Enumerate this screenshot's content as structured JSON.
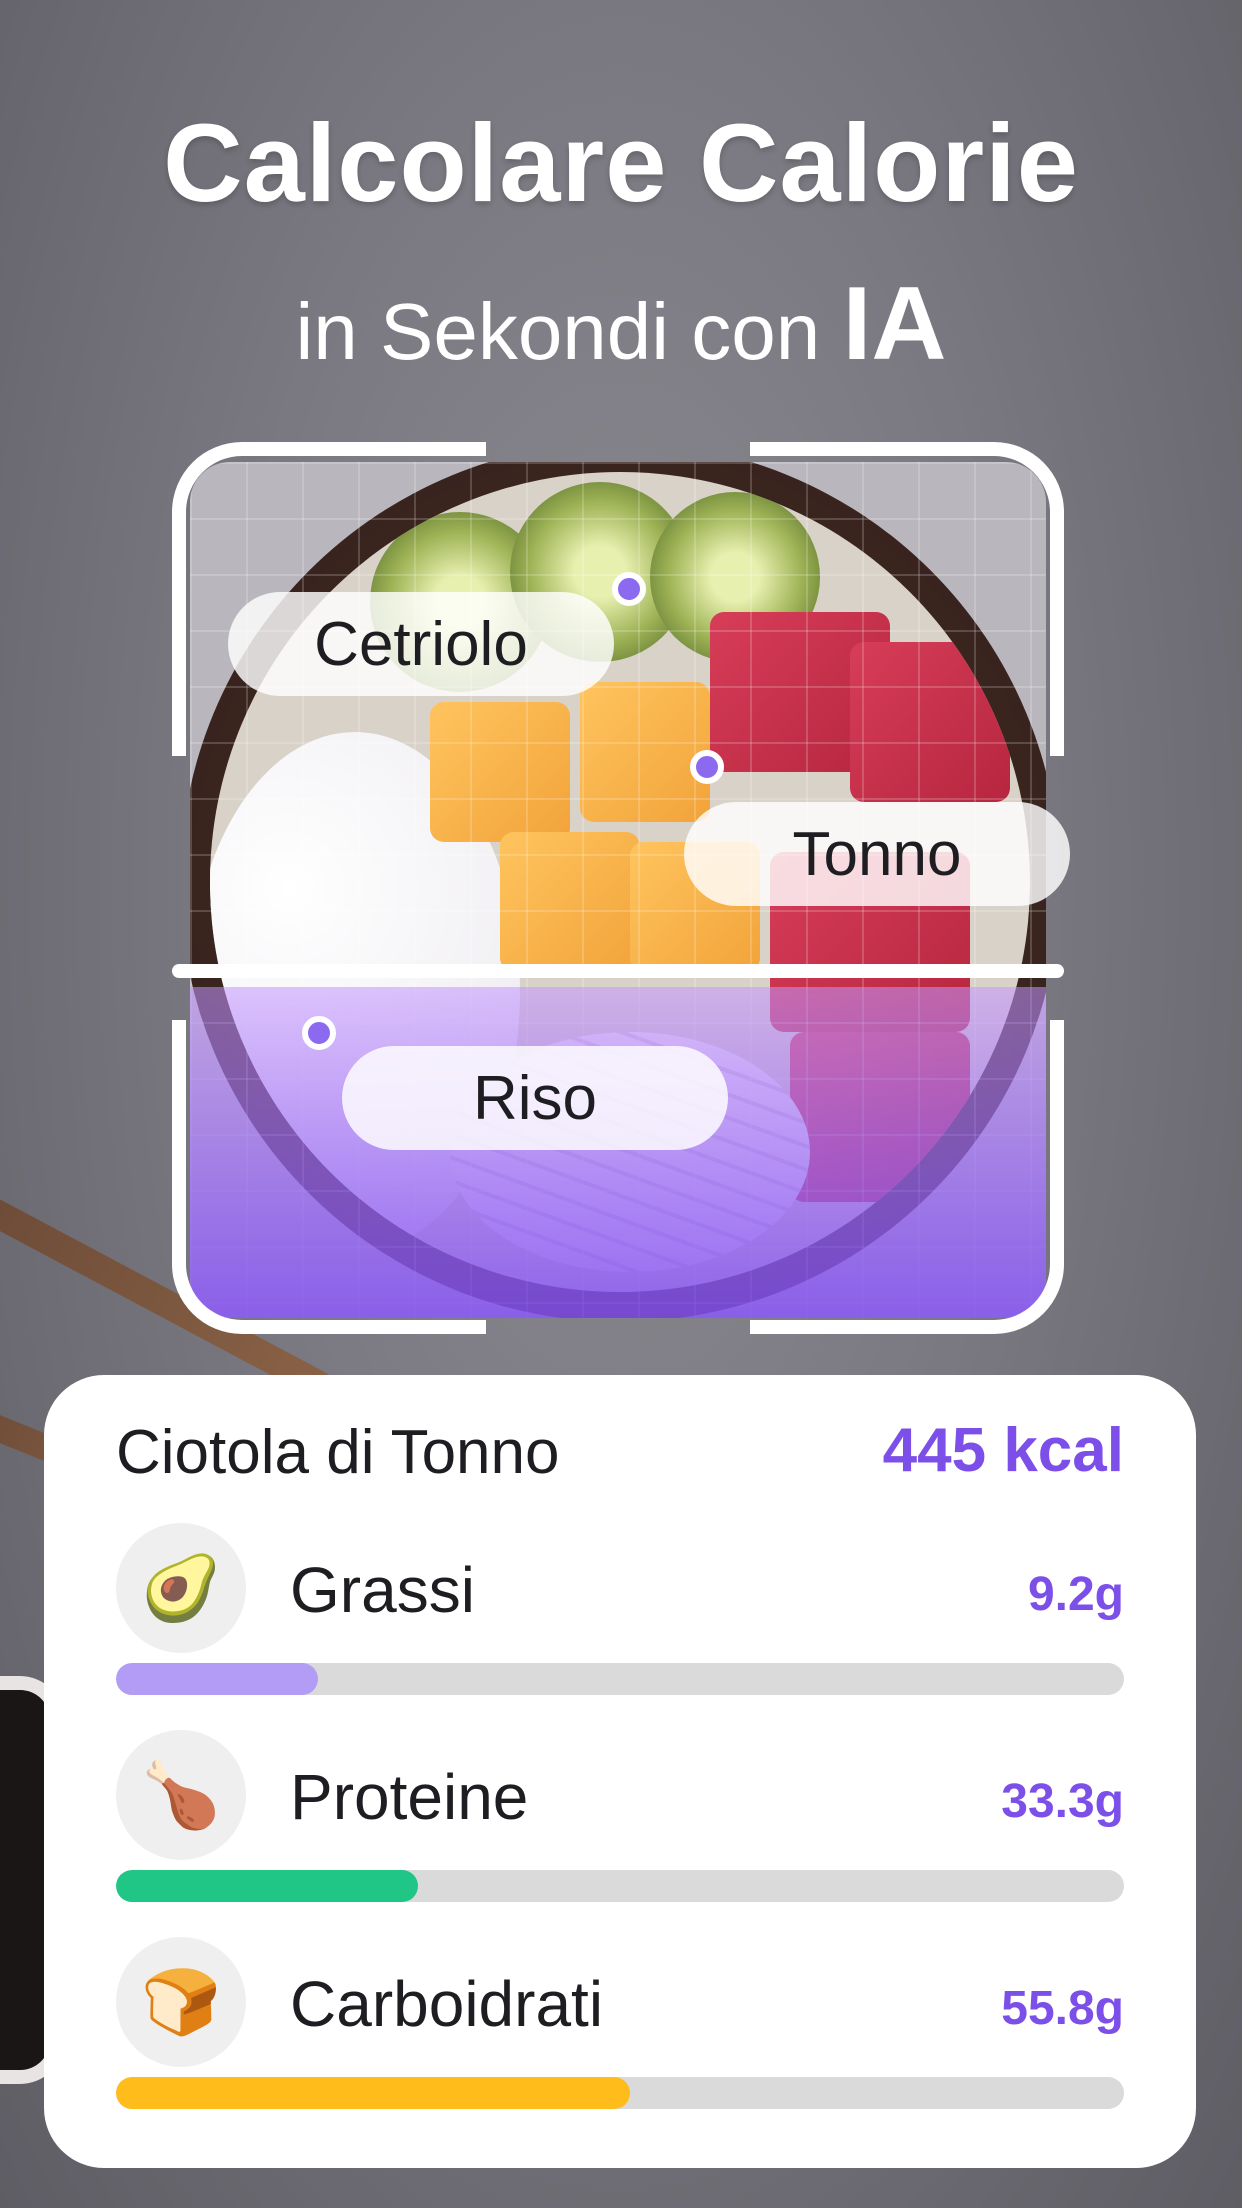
{
  "headline": {
    "line1": "Calcolare Calorie",
    "line2_prefix": "in Sekondi con",
    "line2_emphasis": "IA"
  },
  "scan_labels": {
    "cucumber": "Cetriolo",
    "tuna": "Tonno",
    "rice": "Riso"
  },
  "card": {
    "title": "Ciotola di Tonno",
    "calories": "445 kcal",
    "macros": [
      {
        "icon": "avocado-icon",
        "glyph": "🥑",
        "label": "Grassi",
        "value": "9.2g",
        "progress": 0.2,
        "color": "#b39cf6"
      },
      {
        "icon": "chicken-leg-icon",
        "glyph": "🍗",
        "label": "Proteine",
        "value": "33.3g",
        "progress": 0.3,
        "color": "#1fc686"
      },
      {
        "icon": "bread-icon",
        "glyph": "🍞",
        "label": "Carboidrati",
        "value": "55.8g",
        "progress": 0.51,
        "color": "#ffbc1b"
      }
    ]
  }
}
